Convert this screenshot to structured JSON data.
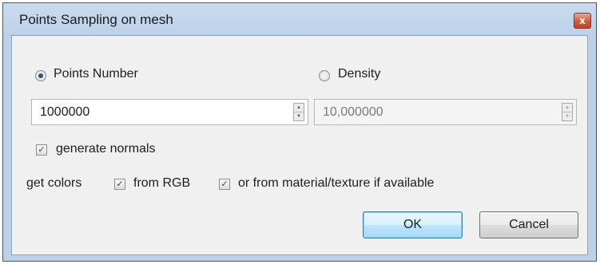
{
  "window": {
    "title": "Points Sampling on mesh",
    "close_symbol": "x"
  },
  "mode": {
    "points_number": {
      "label": "Points Number",
      "selected": true
    },
    "density": {
      "label": "Density",
      "selected": false
    }
  },
  "points_number_field": {
    "value": "1000000",
    "up": "▲",
    "down": "▼"
  },
  "density_field": {
    "value": "10,000000",
    "up": "▲",
    "down": "▼",
    "enabled": false
  },
  "generate_normals": {
    "label": "generate normals",
    "checked": true
  },
  "colors": {
    "label": "get colors",
    "from_rgb": {
      "label": "from RGB",
      "checked": true
    },
    "from_material": {
      "label": "or from material/texture if available",
      "checked": true
    }
  },
  "check_mark": "✓",
  "buttons": {
    "ok": "OK",
    "cancel": "Cancel"
  }
}
